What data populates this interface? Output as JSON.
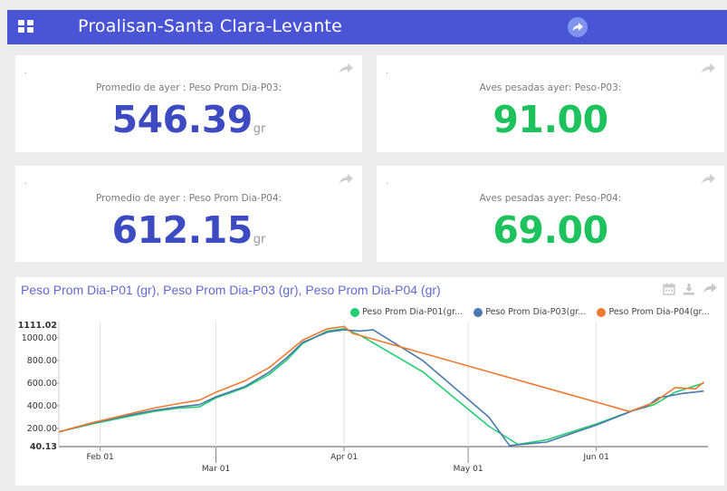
{
  "header": {
    "title": "Proalisan-Santa Clara-Levante",
    "menu_icon": "grid-icon",
    "share_icon": "share-icon",
    "color": "#4a55d6"
  },
  "cards": [
    {
      "dot": ".",
      "label": "Promedio de ayer : Peso Prom Dia-P03:",
      "value": "546.39",
      "unit": "gr",
      "color": "#3d4bc2"
    },
    {
      "dot": ".",
      "label": "Aves pesadas ayer: Peso-P03:",
      "value": "91.00",
      "unit": "",
      "color": "#1ec25c"
    },
    {
      "dot": ".",
      "label": "Promedio de ayer : Peso Prom Dia-P04:",
      "value": "612.15",
      "unit": "gr",
      "color": "#3d4bc2"
    },
    {
      "dot": ".",
      "label": "Aves pesadas ayer: Peso-P04:",
      "value": "69.00",
      "unit": "",
      "color": "#1ec25c"
    }
  ],
  "chart_panel": {
    "title": "Peso Prom Dia-P01 (gr), Peso Prom Dia-P03 (gr), Peso Prom Dia-P04 (gr)",
    "tools": [
      "calendar-icon",
      "download-icon",
      "share-icon"
    ]
  },
  "chart_data": {
    "type": "line",
    "ylim": [
      40.13,
      1111.02
    ],
    "y_extremes_labels": [
      "1111.02",
      "40.13"
    ],
    "yticks": [
      200,
      400,
      600,
      800,
      1000
    ],
    "ytick_labels": [
      "200.00",
      "400.00",
      "600.00",
      "800.00",
      "1000.00"
    ],
    "xlim": [
      "2019-01-22",
      "2019-06-28"
    ],
    "xticks": [
      {
        "date": "2019-02-01",
        "label": "Feb 01",
        "row": 0
      },
      {
        "date": "2019-03-01",
        "label": "Mar 01",
        "row": 1
      },
      {
        "date": "2019-04-01",
        "label": "Apr 01",
        "row": 0
      },
      {
        "date": "2019-05-01",
        "label": "May 01",
        "row": 1
      },
      {
        "date": "2019-06-01",
        "label": "Jun 01",
        "row": 0
      }
    ],
    "grid_x": true,
    "legend_position": "top-right",
    "series": [
      {
        "name": "Peso Prom Dia-P01(gr...",
        "color": "#1fcf71",
        "points": [
          [
            "2019-01-22",
            170
          ],
          [
            "2019-01-30",
            240
          ],
          [
            "2019-02-07",
            300
          ],
          [
            "2019-02-14",
            350
          ],
          [
            "2019-02-20",
            380
          ],
          [
            "2019-02-25",
            390
          ],
          [
            "2019-03-01",
            470
          ],
          [
            "2019-03-08",
            560
          ],
          [
            "2019-03-14",
            680
          ],
          [
            "2019-03-18",
            800
          ],
          [
            "2019-03-22",
            950
          ],
          [
            "2019-03-28",
            1060
          ],
          [
            "2019-04-01",
            1080
          ],
          [
            "2019-04-05",
            1020
          ],
          [
            "2019-04-20",
            700
          ],
          [
            "2019-05-06",
            220
          ],
          [
            "2019-05-13",
            60
          ],
          [
            "2019-05-20",
            100
          ],
          [
            "2019-06-01",
            240
          ],
          [
            "2019-06-10",
            360
          ],
          [
            "2019-06-15",
            410
          ],
          [
            "2019-06-20",
            520
          ],
          [
            "2019-06-27",
            600
          ]
        ]
      },
      {
        "name": "Peso Prom Dia-P03(gr...",
        "color": "#4a79ad",
        "points": [
          [
            "2019-01-22",
            170
          ],
          [
            "2019-01-30",
            245
          ],
          [
            "2019-02-07",
            310
          ],
          [
            "2019-02-14",
            360
          ],
          [
            "2019-02-20",
            390
          ],
          [
            "2019-02-25",
            410
          ],
          [
            "2019-03-01",
            480
          ],
          [
            "2019-03-08",
            570
          ],
          [
            "2019-03-14",
            700
          ],
          [
            "2019-03-18",
            820
          ],
          [
            "2019-03-22",
            960
          ],
          [
            "2019-03-28",
            1050
          ],
          [
            "2019-04-01",
            1070
          ],
          [
            "2019-04-05",
            1060
          ],
          [
            "2019-04-08",
            1070
          ],
          [
            "2019-04-20",
            800
          ],
          [
            "2019-05-06",
            300
          ],
          [
            "2019-05-11",
            50
          ],
          [
            "2019-05-20",
            80
          ],
          [
            "2019-06-01",
            230
          ],
          [
            "2019-06-10",
            360
          ],
          [
            "2019-06-13",
            390
          ],
          [
            "2019-06-16",
            470
          ],
          [
            "2019-06-22",
            510
          ],
          [
            "2019-06-27",
            530
          ]
        ]
      },
      {
        "name": "Peso Prom Dia-P04(gr...",
        "color": "#f07a30",
        "points": [
          [
            "2019-01-22",
            170
          ],
          [
            "2019-01-30",
            250
          ],
          [
            "2019-02-07",
            320
          ],
          [
            "2019-02-14",
            380
          ],
          [
            "2019-02-20",
            420
          ],
          [
            "2019-02-25",
            450
          ],
          [
            "2019-03-01",
            520
          ],
          [
            "2019-03-08",
            620
          ],
          [
            "2019-03-14",
            740
          ],
          [
            "2019-03-18",
            860
          ],
          [
            "2019-03-22",
            980
          ],
          [
            "2019-03-28",
            1080
          ],
          [
            "2019-04-01",
            1100
          ],
          [
            "2019-04-03",
            1040
          ],
          [
            "2019-06-09",
            350
          ],
          [
            "2019-06-15",
            430
          ],
          [
            "2019-06-20",
            560
          ],
          [
            "2019-06-25",
            550
          ],
          [
            "2019-06-27",
            610
          ]
        ]
      }
    ]
  }
}
